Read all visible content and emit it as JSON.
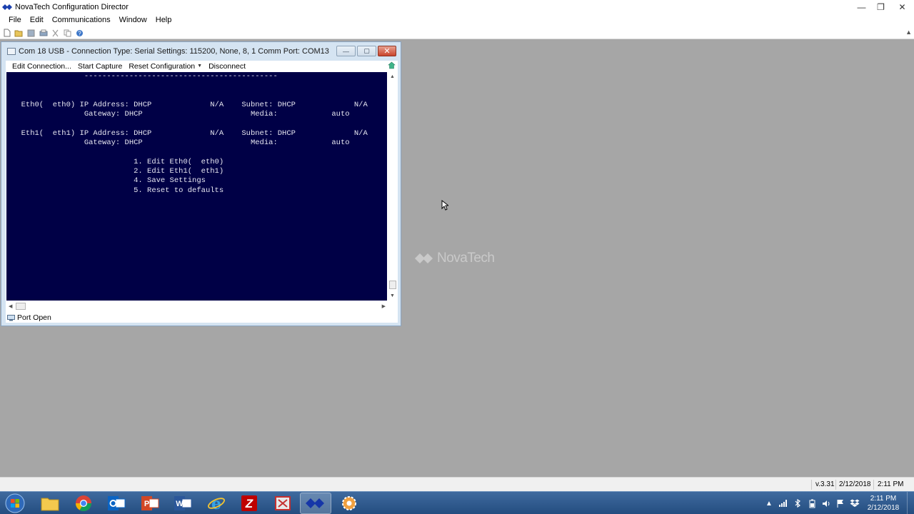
{
  "app": {
    "title": "NovaTech Configuration Director",
    "window_controls": {
      "minimize": "—",
      "maximize": "❐",
      "close": "✕"
    }
  },
  "menubar": {
    "items": [
      "File",
      "Edit",
      "Communications",
      "Window",
      "Help"
    ]
  },
  "toolbar": {
    "buttons": [
      "new-file-icon",
      "open-folder-icon",
      "save-icon",
      "print-icon",
      "cut-icon",
      "copy-icon",
      "help-icon"
    ]
  },
  "watermark": {
    "text": "NovaTech"
  },
  "child_window": {
    "title": "Com 18 USB - Connection Type: Serial   Settings: 115200, None, 8, 1   Comm Port: COM13",
    "controls": {
      "minimize": "—",
      "maximize": "▢",
      "close": "✕"
    },
    "toolbar": {
      "edit_connection": "Edit Connection...",
      "start_capture": "Start Capture",
      "reset_configuration": "Reset Configuration",
      "disconnect": "Disconnect"
    },
    "terminal": {
      "lines": [
        {
          "text": "                -------------------------------------------",
          "row": 0
        },
        {
          "text": "  Eth0(  eth0) IP Address: DHCP             N/A    Subnet: DHCP             N/A",
          "row": 3
        },
        {
          "text": "                Gateway: DHCP                        Media:            auto",
          "row": 4
        },
        {
          "text": "  Eth1(  eth1) IP Address: DHCP             N/A    Subnet: DHCP             N/A",
          "row": 6
        },
        {
          "text": "                Gateway: DHCP                        Media:            auto",
          "row": 7
        },
        {
          "text": "                           1. Edit Eth0(  eth0)",
          "row": 9
        },
        {
          "text": "                           2. Edit Eth1(  eth1)",
          "row": 10
        },
        {
          "text": "                           4. Save Settings",
          "row": 11
        },
        {
          "text": "                           5. Reset to defaults",
          "row": 12
        }
      ]
    },
    "status": "Port Open"
  },
  "app_status": {
    "version": "v.3.31",
    "date": "2/12/2018",
    "time": "2:11 PM"
  },
  "taskbar": {
    "apps": [
      "windows-explorer-icon",
      "chrome-icon",
      "outlook-icon",
      "powerpoint-icon",
      "word-icon",
      "internet-explorer-icon",
      "filezilla-icon",
      "snipping-tool-icon",
      "novatech-icon",
      "settings-gear-icon"
    ],
    "clock_time": "2:11 PM",
    "clock_date": "2/12/2018"
  },
  "colors": {
    "terminal_bg": "#000046",
    "terminal_fg": "#e6e6f0",
    "desktop_bg": "#a6a6a6",
    "taskbar": "#2d5a8e"
  }
}
